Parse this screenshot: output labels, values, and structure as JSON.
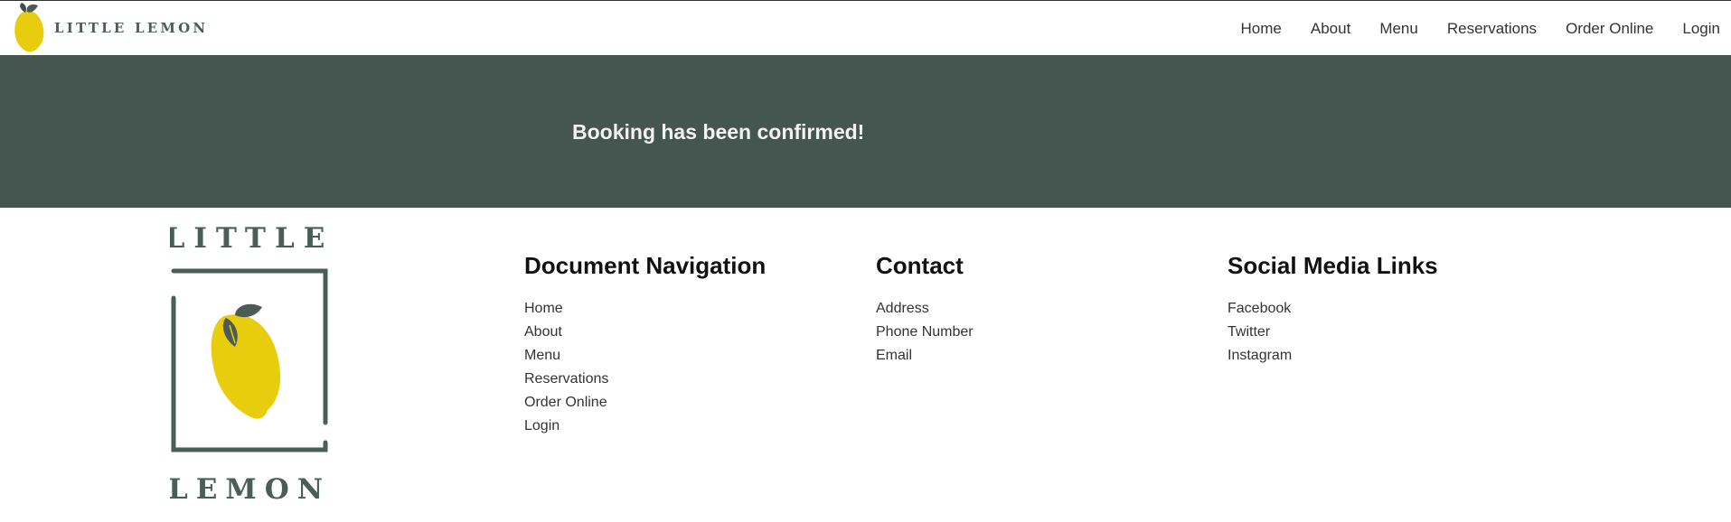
{
  "header": {
    "brand_name": "LITTLE LEMON",
    "nav": [
      "Home",
      "About",
      "Menu",
      "Reservations",
      "Order Online",
      "Login"
    ]
  },
  "banner": {
    "message": "Booking has been confirmed!"
  },
  "footer": {
    "logo_top_text": "LITTLE",
    "logo_bottom_text": "LEMON",
    "columns": [
      {
        "title": "Document Navigation",
        "items": [
          "Home",
          "About",
          "Menu",
          "Reservations",
          "Order Online",
          "Login"
        ]
      },
      {
        "title": "Contact",
        "items": [
          "Address",
          "Phone Number",
          "Email"
        ]
      },
      {
        "title": "Social Media Links",
        "items": [
          "Facebook",
          "Twitter",
          "Instagram"
        ]
      }
    ]
  },
  "colors": {
    "brand_green": "#495e57",
    "banner_bg": "#455651",
    "lemon_yellow": "#e8cc0e",
    "leaf_green": "#4b5c56"
  }
}
